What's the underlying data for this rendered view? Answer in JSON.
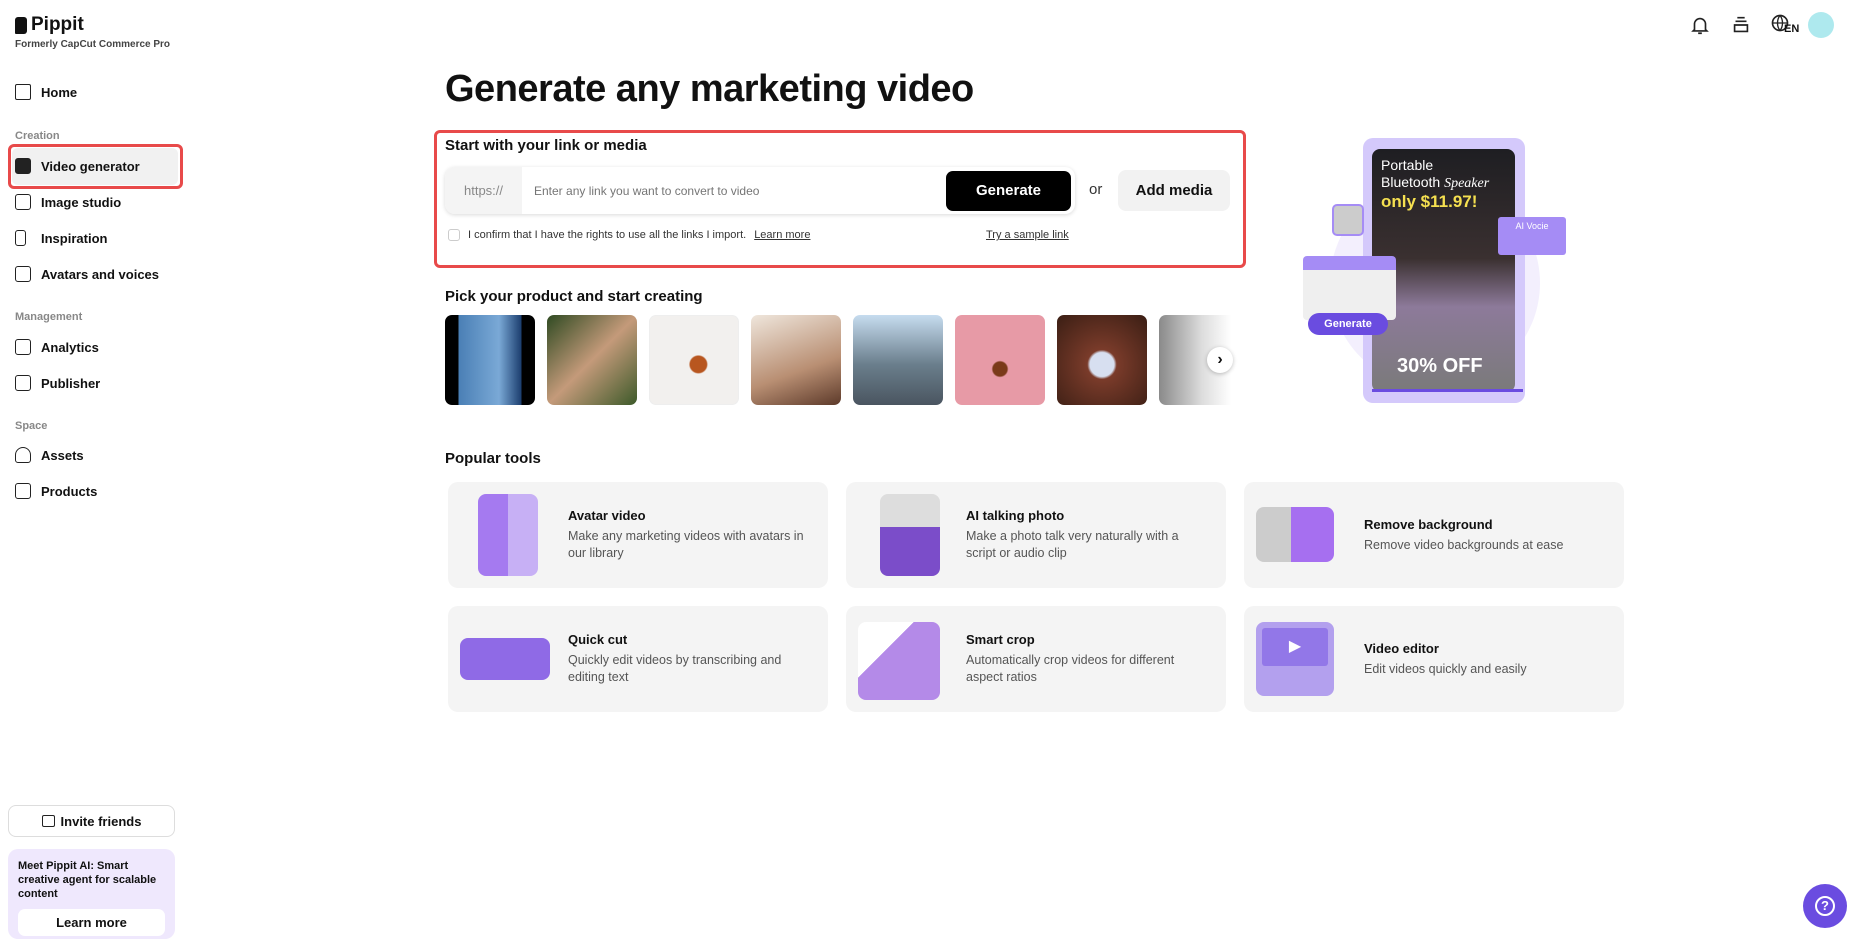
{
  "brand": {
    "name": "Pippit",
    "tagline": "Formerly CapCut Commerce Pro"
  },
  "sidebar": {
    "home": "Home",
    "sections": [
      {
        "label": "Creation",
        "items": [
          "Video generator",
          "Image studio",
          "Inspiration",
          "Avatars and voices"
        ]
      },
      {
        "label": "Management",
        "items": [
          "Analytics",
          "Publisher"
        ]
      },
      {
        "label": "Space",
        "items": [
          "Assets",
          "Products"
        ]
      }
    ],
    "active": "Video generator",
    "invite": "Invite friends",
    "promo": {
      "bold": "Meet Pippit AI:",
      "text": " Smart creative agent for scalable content",
      "button": "Learn more"
    }
  },
  "header": {
    "language": "EN"
  },
  "main": {
    "title": "Generate any marketing video",
    "link_section": {
      "heading": "Start with your link or media",
      "prefix": "https://",
      "placeholder": "Enter any link you want to convert to video",
      "generate": "Generate",
      "or": "or",
      "add_media": "Add media",
      "confirm": "I confirm that I have the rights to use all the links I import.",
      "learn_more": "Learn more",
      "sample": "Try a sample link"
    },
    "products_heading": "Pick your product and start creating",
    "popular_heading": "Popular tools",
    "tools": [
      {
        "title": "Avatar video",
        "desc": "Make any marketing videos with avatars in our library"
      },
      {
        "title": "AI talking photo",
        "desc": "Make a photo talk very naturally with a script or audio clip"
      },
      {
        "title": "Remove background",
        "desc": "Remove video backgrounds at ease"
      },
      {
        "title": "Quick cut",
        "desc": "Quickly edit videos by transcribing and editing text"
      },
      {
        "title": "Smart crop",
        "desc": "Automatically crop videos for different aspect ratios"
      },
      {
        "title": "Video editor",
        "desc": "Edit videos quickly and easily"
      }
    ],
    "hero": {
      "line1": "Portable",
      "line2": "Bluetooth",
      "line2b": "Speaker",
      "price": "only $11.97!",
      "ai_voice": "AI Vocie",
      "generate": "Generate",
      "discount": "30% OFF"
    }
  },
  "colors": {
    "accent": "#6a4ce0",
    "highlight": "#e84a4a"
  }
}
